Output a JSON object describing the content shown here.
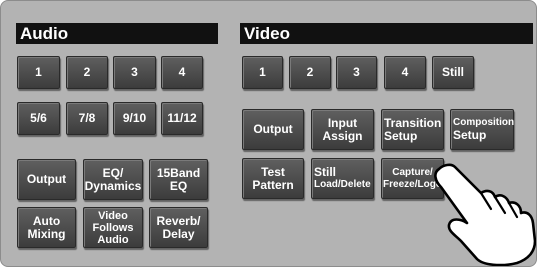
{
  "audio": {
    "title": "Audio",
    "channel_buttons": [
      "1",
      "2",
      "3",
      "4"
    ],
    "pair_buttons": [
      "5/6",
      "7/8",
      "9/10",
      "11/12"
    ],
    "function_buttons": [
      {
        "line1": "Output",
        "line2": ""
      },
      {
        "line1": "EQ/",
        "line2": "Dynamics"
      },
      {
        "line1": "15Band",
        "line2": "EQ"
      },
      {
        "line1": "Auto",
        "line2": "Mixing"
      },
      {
        "line1": "Video",
        "line2": "Follows",
        "line3": "Audio"
      },
      {
        "line1": "Reverb/",
        "line2": "Delay"
      }
    ]
  },
  "video": {
    "title": "Video",
    "channel_buttons": [
      "1",
      "2",
      "3",
      "4",
      "Still"
    ],
    "function_buttons": [
      {
        "line1": "Output",
        "line2": ""
      },
      {
        "line1": "Input",
        "line2": "Assign"
      },
      {
        "line1": "Transition",
        "line2": "Setup"
      },
      {
        "line1": "Composition",
        "line2": "Setup"
      },
      {
        "line1": "Test",
        "line2": "Pattern"
      },
      {
        "line1": "Still",
        "line2": "Load/Delete"
      },
      {
        "line1": "Capture/",
        "line2": "Freeze/Logo"
      }
    ]
  },
  "colors": {
    "panel": "#b3b3b3",
    "button": "#4a4a4a",
    "header": "#111111",
    "text": "#ffffff"
  },
  "icons": {
    "pointer": "pointing-hand-icon"
  }
}
